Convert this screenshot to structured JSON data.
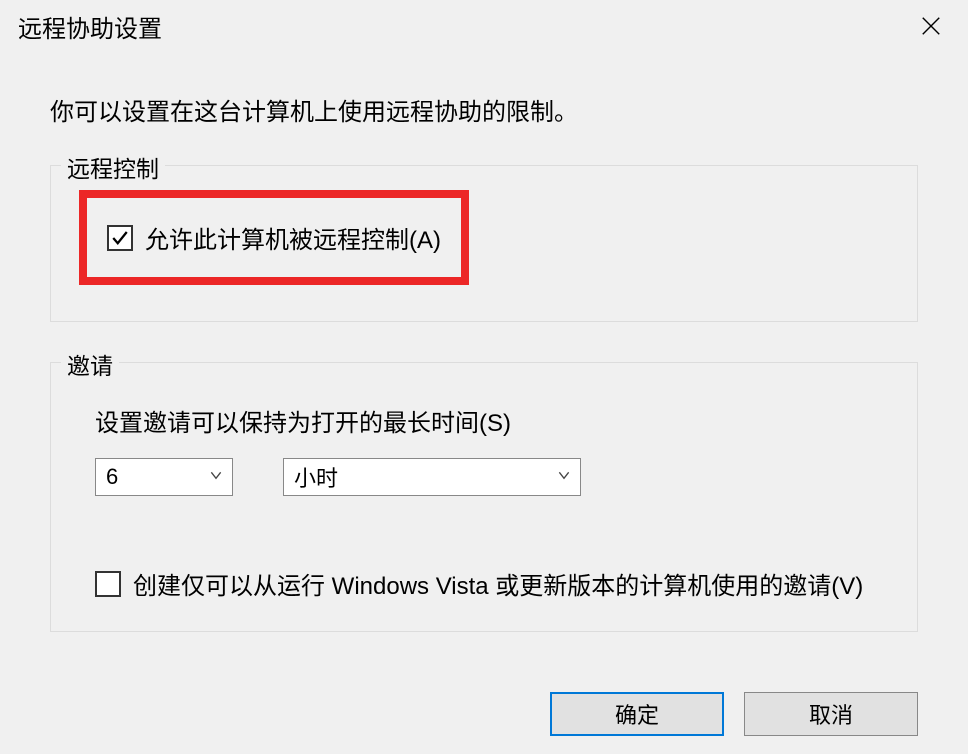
{
  "titlebar": {
    "title": "远程协助设置"
  },
  "description": "你可以设置在这台计算机上使用远程协助的限制。",
  "remoteControl": {
    "legend": "远程控制",
    "allowCheckbox": {
      "checked": true,
      "label": "允许此计算机被远程控制(A)"
    }
  },
  "invitations": {
    "legend": "邀请",
    "durationLabel": "设置邀请可以保持为打开的最长时间(S)",
    "durationValue": "6",
    "durationUnit": "小时",
    "vistaCheckbox": {
      "checked": false,
      "label": "创建仅可以从运行 Windows Vista 或更新版本的计算机使用的邀请(V)"
    }
  },
  "buttons": {
    "ok": "确定",
    "cancel": "取消"
  }
}
